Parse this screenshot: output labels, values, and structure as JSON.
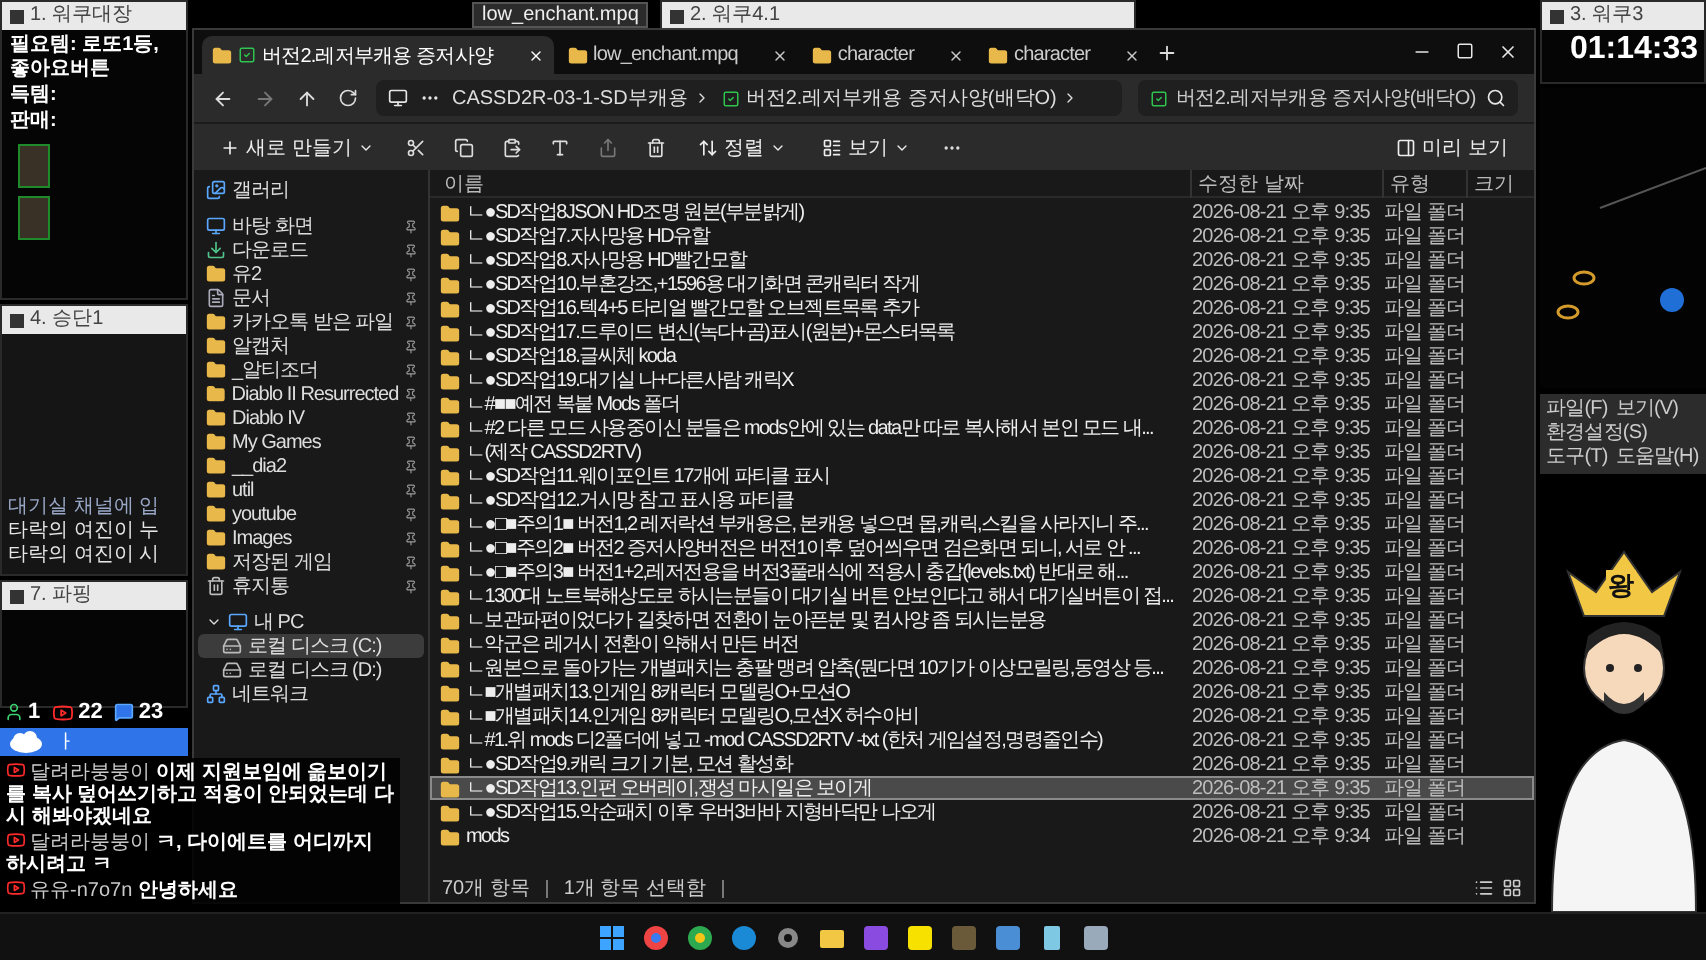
{
  "left_window": {
    "title": "1. 워쿠대장",
    "notes": [
      "필요템: 로또1등, 좋아요버튼",
      "득템:",
      "판매:"
    ]
  },
  "top_window": {
    "title": "2. 워쿠4.1"
  },
  "tooltip": "low_enchant.mpq",
  "right_window": {
    "title": "3. 워쿠3"
  },
  "timer": "01:14:33",
  "game_window": {
    "title": "4. 승단1",
    "lines": [
      "대기실 채널에 입",
      "타락의 여진이 누",
      "타락의 여진이 시"
    ]
  },
  "lower_window": {
    "title": "7. 파핑"
  },
  "viewers": [
    {
      "kind": "person",
      "count": "1"
    },
    {
      "kind": "youtube",
      "count": "22"
    },
    {
      "kind": "chat",
      "count": "23"
    }
  ],
  "banner": {
    "text": "ㅏ"
  },
  "chat": [
    {
      "kind": "youtube",
      "author": "달려라붕붕이",
      "text": "이제 지원보임에 옮보이기 를 복사 덮어쓰기하고 적용이 안되었는데 다시 해봐야겠네요"
    },
    {
      "kind": "youtube",
      "author": "달려라붕붕이",
      "text": "ㅋ, 다이에트를 어디까지 하시려고 ㅋ"
    },
    {
      "kind": "youtube",
      "author": "유유-n7o7n",
      "text": "안녕하세요"
    }
  ],
  "explorer": {
    "tabs": [
      {
        "label": "버전2.레저부캐용 증저사양",
        "selected": true
      },
      {
        "label": "low_enchant.mpq",
        "selected": false
      },
      {
        "label": "character",
        "selected": false
      },
      {
        "label": "character",
        "selected": false
      }
    ],
    "breadcrumb": [
      "CASSD2R-03-1-SD부캐용",
      "버전2.레저부캐용 증저사양(배닥O)"
    ],
    "search": {
      "placeholder": "버전2.레저부캐용 증저사양(배닥O)"
    },
    "toolbar": {
      "new": "새로 만들기",
      "sort": "정렬",
      "view": "보기",
      "preview": "미리 보기"
    },
    "sidebar": [
      {
        "label": "갤러리",
        "kind": "gallery",
        "pinned": false,
        "selected": false
      },
      {
        "label": "바탕 화면",
        "kind": "desktop",
        "pinned": true,
        "selected": false
      },
      {
        "label": "다운로드",
        "kind": "download",
        "pinned": true,
        "selected": false
      },
      {
        "label": "유2",
        "kind": "folder",
        "pinned": true,
        "selected": false
      },
      {
        "label": "문서",
        "kind": "document",
        "pinned": true,
        "selected": false
      },
      {
        "label": "카카오톡 받은 파일",
        "kind": "folder",
        "pinned": true,
        "selected": false
      },
      {
        "label": "알캡처",
        "kind": "folder",
        "pinned": true,
        "selected": false
      },
      {
        "label": "_알티조더",
        "kind": "folder",
        "pinned": true,
        "selected": false
      },
      {
        "label": "Diablo II Resurrected",
        "kind": "folder",
        "pinned": true,
        "selected": false
      },
      {
        "label": "Diablo IV",
        "kind": "folder",
        "pinned": true,
        "selected": false
      },
      {
        "label": "My Games",
        "kind": "folder",
        "pinned": true,
        "selected": false
      },
      {
        "label": "__dia2",
        "kind": "folder",
        "pinned": true,
        "selected": false
      },
      {
        "label": "util",
        "kind": "folder",
        "pinned": true,
        "selected": false
      },
      {
        "label": "youtube",
        "kind": "folder",
        "pinned": true,
        "selected": false
      },
      {
        "label": "Images",
        "kind": "folder",
        "pinned": true,
        "selected": false
      },
      {
        "label": "저장된 게임",
        "kind": "folder",
        "pinned": true,
        "selected": false
      },
      {
        "label": "휴지통",
        "kind": "trash",
        "pinned": true,
        "selected": false
      },
      {
        "label": "내 PC",
        "kind": "pc",
        "pinned": false,
        "selected": false,
        "expanded": true,
        "children": [
          {
            "label": "로컬 디스크 (C:)",
            "kind": "drive",
            "pinned": false,
            "selected": true
          },
          {
            "label": "로컬 디스크 (D:)",
            "kind": "drive",
            "pinned": false,
            "selected": false
          }
        ]
      },
      {
        "label": "네트워크",
        "kind": "network",
        "pinned": false,
        "selected": false
      }
    ],
    "columns": [
      "이름",
      "수정한 날짜",
      "유형",
      "크기"
    ],
    "rows": [
      {
        "name": "ㄴ●SD작업8JSON HD조명 원본(부분밝게)",
        "modified": "2026-08-21 오후 9:35",
        "type": "파일 폴더",
        "selected": false
      },
      {
        "name": "ㄴ●SD작업7.자사망용 HD유할",
        "modified": "2026-08-21 오후 9:35",
        "type": "파일 폴더",
        "selected": false
      },
      {
        "name": "ㄴ●SD작업8.자사망용 HD빨간모할",
        "modified": "2026-08-21 오후 9:35",
        "type": "파일 폴더",
        "selected": false
      },
      {
        "name": "ㄴ●SD작업10.부혼강조,+1596용 대기화면 콘캐릭터 작게",
        "modified": "2026-08-21 오후 9:35",
        "type": "파일 폴더",
        "selected": false
      },
      {
        "name": "ㄴ●SD작업16.텍4+5 타리얼 빨간모할 오브젝트목록 추가",
        "modified": "2026-08-21 오후 9:35",
        "type": "파일 폴더",
        "selected": false
      },
      {
        "name": "ㄴ●SD작업17.드루이드 변신(녹다+곰)표시(원본)+몬스터목록",
        "modified": "2026-08-21 오후 9:35",
        "type": "파일 폴더",
        "selected": false
      },
      {
        "name": "ㄴ●SD작업18.글씨체 koda",
        "modified": "2026-08-21 오후 9:35",
        "type": "파일 폴더",
        "selected": false
      },
      {
        "name": "ㄴ●SD작업19.대기실 나+다른사람 캐릭X",
        "modified": "2026-08-21 오후 9:35",
        "type": "파일 폴더",
        "selected": false
      },
      {
        "name": "ㄴ#■■예전 복붙 Mods 폴더",
        "modified": "2026-08-21 오후 9:35",
        "type": "파일 폴더",
        "selected": false
      },
      {
        "name": "ㄴ#2 다른 모드 사용중이신 분들은 mods안에 있는 data만 따로 복사해서 본인 모드 내...",
        "modified": "2026-08-21 오후 9:35",
        "type": "파일 폴더",
        "selected": false
      },
      {
        "name": "ㄴ(제작 CASSD2RTV)",
        "modified": "2026-08-21 오후 9:35",
        "type": "파일 폴더",
        "selected": false
      },
      {
        "name": "ㄴ●SD작업11.웨이포인트 17개에 파티클 표시",
        "modified": "2026-08-21 오후 9:35",
        "type": "파일 폴더",
        "selected": false
      },
      {
        "name": "ㄴ●SD작업12.거시망 참고 표시용 파티클",
        "modified": "2026-08-21 오후 9:35",
        "type": "파일 폴더",
        "selected": false
      },
      {
        "name": "ㄴ●□■주의1■ 버전1,2 레저락션 부캐용은, 본캐용 넣으면 몹,캐릭,스킬을 사라지니 주...",
        "modified": "2026-08-21 오후 9:35",
        "type": "파일 폴더",
        "selected": false
      },
      {
        "name": "ㄴ●□■주의2■ 버전2 증저사양버전은 버전1이후 덮어씌우면 검은화면 되니, 서로 안 ...",
        "modified": "2026-08-21 오후 9:35",
        "type": "파일 폴더",
        "selected": false
      },
      {
        "name": "ㄴ●□■주의3■ 버전1+2,레저전용을 버전3풀래식에 적용시 충갑(levels.txt) 반대로 해...",
        "modified": "2026-08-21 오후 9:35",
        "type": "파일 폴더",
        "selected": false
      },
      {
        "name": "ㄴ1300대 노트북해상도로 하시는분들이 대기실 버튼 안보인다고 해서 대기실버튼이 접...",
        "modified": "2026-08-21 오후 9:35",
        "type": "파일 폴더",
        "selected": false
      },
      {
        "name": "ㄴ보관파편이었다가 길찾하면 전환이 눈아픈분 및 컴사양 좀 되시는분용",
        "modified": "2026-08-21 오후 9:35",
        "type": "파일 폴더",
        "selected": false
      },
      {
        "name": "ㄴ악군은 레거시 전환이 약해서 만든 버전",
        "modified": "2026-08-21 오후 9:35",
        "type": "파일 폴더",
        "selected": false
      },
      {
        "name": "ㄴ원본으로 돌아가는 개별패치는 충팔 맹려 압축(뭔다면 10기가 이상모릴링,동영상 등...",
        "modified": "2026-08-21 오후 9:35",
        "type": "파일 폴더",
        "selected": false
      },
      {
        "name": "ㄴ■개별패치13.인게임 8캐릭터 모델링O+모션O",
        "modified": "2026-08-21 오후 9:35",
        "type": "파일 폴더",
        "selected": false
      },
      {
        "name": "ㄴ■개별패치14.인게임 8캐릭터 모델링O,모션X 허수아비",
        "modified": "2026-08-21 오후 9:35",
        "type": "파일 폴더",
        "selected": false
      },
      {
        "name": "ㄴ#1.위 mods 디2폴더에 넣고 -mod CASSD2RTV -txt (한처 게임설정,명령줄인수)",
        "modified": "2026-08-21 오후 9:35",
        "type": "파일 폴더",
        "selected": false
      },
      {
        "name": "ㄴ●SD작업9.캐릭 크기 기본, 모션 활성화",
        "modified": "2026-08-21 오후 9:35",
        "type": "파일 폴더",
        "selected": false
      },
      {
        "name": "ㄴ●SD작업13.인펀 오버레이,쟁성 마시일은 보이게",
        "modified": "2026-08-21 오후 9:35",
        "type": "파일 폴더",
        "selected": true
      },
      {
        "name": "ㄴ●SD작업15.악순패치 이후 우버3바바 지형바닥만 나오게",
        "modified": "2026-08-21 오후 9:35",
        "type": "파일 폴더",
        "selected": false
      },
      {
        "name": "mods",
        "modified": "2026-08-21 오후 9:34",
        "type": "파일 폴더",
        "selected": false
      }
    ],
    "status": [
      "70개 항목",
      "1개 항목 선택함"
    ]
  },
  "avatar_panel": {
    "menu": [
      "파일(F)",
      "보기(V)",
      "환경설정(S)",
      "도구(T)",
      "도움말(H)"
    ],
    "crown_text": "왕"
  }
}
